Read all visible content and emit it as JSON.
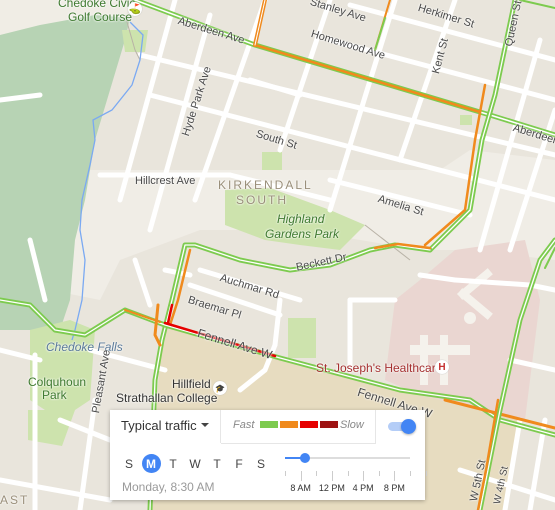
{
  "map": {
    "labels": {
      "golf_course_1": "Chedoke Civic",
      "golf_course_2": "Golf Course",
      "aberdeen_ave": "Aberdeen Ave",
      "aberdeen_ave_east": "Aberdeen",
      "stanley_ave": "Stanley Ave",
      "herkimer_st": "Herkimer St",
      "homewood_ave": "Homewood Ave",
      "kent_st": "Kent St",
      "queen_st": "Queen St",
      "hyde_park_ave": "Hyde Park Ave",
      "south_st": "South St",
      "hillcrest_ave": "Hillcrest Ave",
      "neighbourhood_1": "KIRKENDALL",
      "neighbourhood_2": "SOUTH",
      "highland_1": "Highland",
      "highland_2": "Gardens Park",
      "amelia_st": "Amelia St",
      "beckett_dr": "Beckett Dr",
      "auchmar_rd": "Auchmar Rd",
      "braemar_pl": "Braemar Pl",
      "chedoke_falls": "Chedoke Falls",
      "fennell_ave_w": "Fennell Ave W",
      "fennell_ave_w_2": "Fennell Ave W",
      "colquhoun_1": "Colquhoun",
      "colquhoun_2": "Park",
      "pleasant_ave": "Pleasant Ave",
      "hillfield_1": "Hillfield",
      "hillfield_2": "Strathallan College",
      "st_josephs": "St. Joseph's Healthcare",
      "w_5th_st": "W 5th St",
      "w_4th_st": "W 4th St",
      "east_partial": "AST"
    },
    "icons": {
      "golf": "golf-icon",
      "school": "school-icon",
      "hospital": "hospital-icon",
      "hospital_glyph": "H",
      "school_glyph": "🎓",
      "golf_glyph": "⛳"
    }
  },
  "traffic_panel": {
    "mode_label": "Typical traffic",
    "legend": {
      "fast_label": "Fast",
      "slow_label": "Slow",
      "colors": [
        "#7dcb4f",
        "#f08a1d",
        "#e60000",
        "#9e1313"
      ]
    },
    "toggle_on": true,
    "days": [
      "S",
      "M",
      "T",
      "W",
      "T",
      "F",
      "S"
    ],
    "selected_day_index": 1,
    "selected_time_text": "Monday, 8:30 AM",
    "time_labels": [
      "8 AM",
      "12 PM",
      "4 PM",
      "8 PM"
    ],
    "slider_value_hour": 8.5,
    "slider_range_hours": [
      6,
      22
    ],
    "accent_color": "#4285f4"
  }
}
